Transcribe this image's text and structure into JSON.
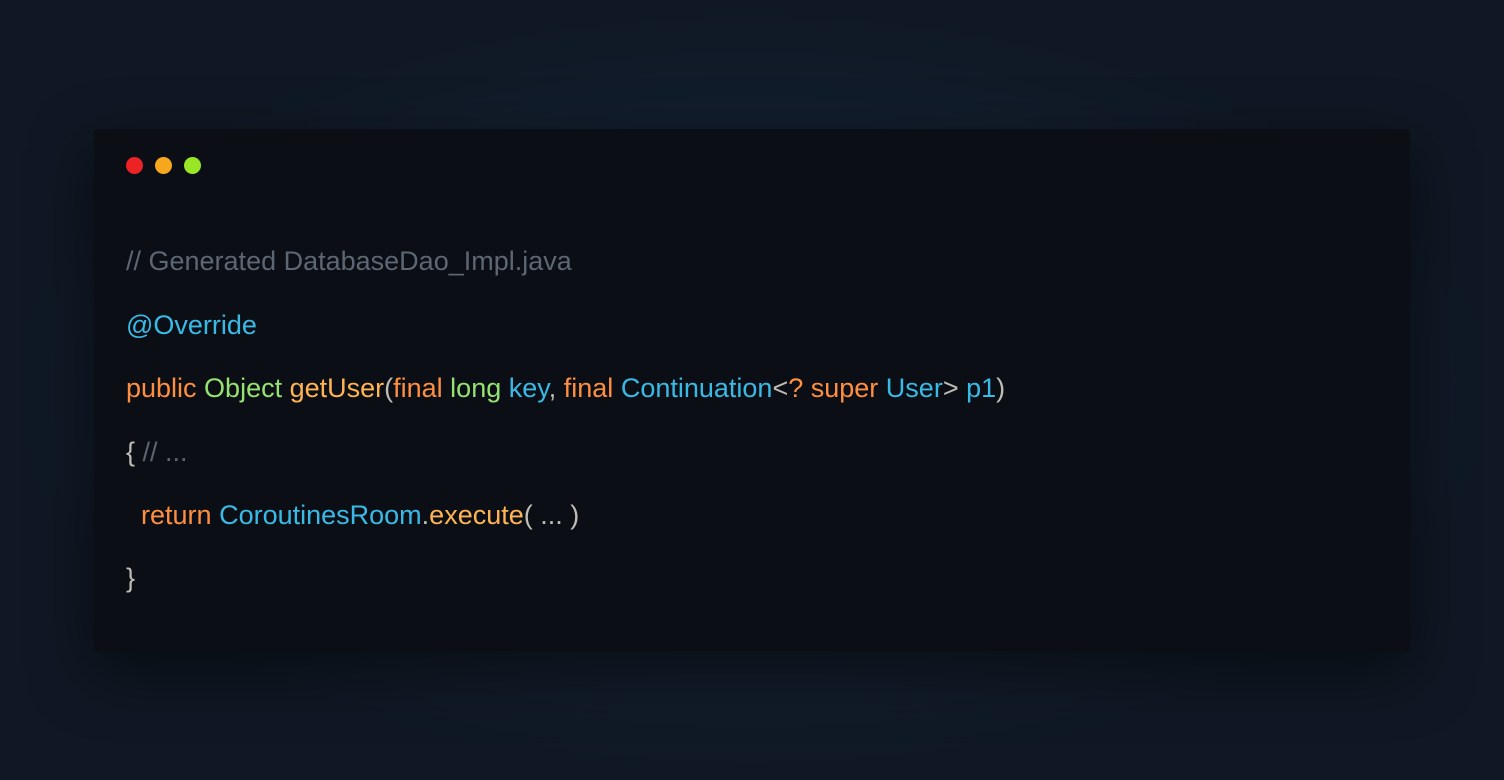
{
  "code": {
    "line1": {
      "comment": "// Generated DatabaseDao_Impl.java"
    },
    "line2": {
      "annotation": "@Override"
    },
    "line3": {
      "kw_public": "public",
      "type_object": " Object",
      "method": " getUser",
      "paren_open": "(",
      "kw_final1": "final",
      "type_long": " long",
      "param_key": " key",
      "comma1": ",",
      "kw_final2": " final",
      "type_cont": " Continuation",
      "generic_open": "<",
      "generic_wild": "?",
      "kw_super": " super",
      "type_user": " User",
      "generic_close": ">",
      "param_p1": " p1",
      "paren_close": ")"
    },
    "line4": {
      "brace_open": "{",
      "comment": " // ..."
    },
    "line5": {
      "indent": "  ",
      "kw_return": "return",
      "type_cr": " CoroutinesRoom",
      "dot": ".",
      "method_exec": "execute",
      "args": "( ... )"
    },
    "line6": {
      "brace_close": "}"
    }
  },
  "window": {
    "close": "close",
    "minimize": "minimize",
    "maximize": "maximize"
  }
}
